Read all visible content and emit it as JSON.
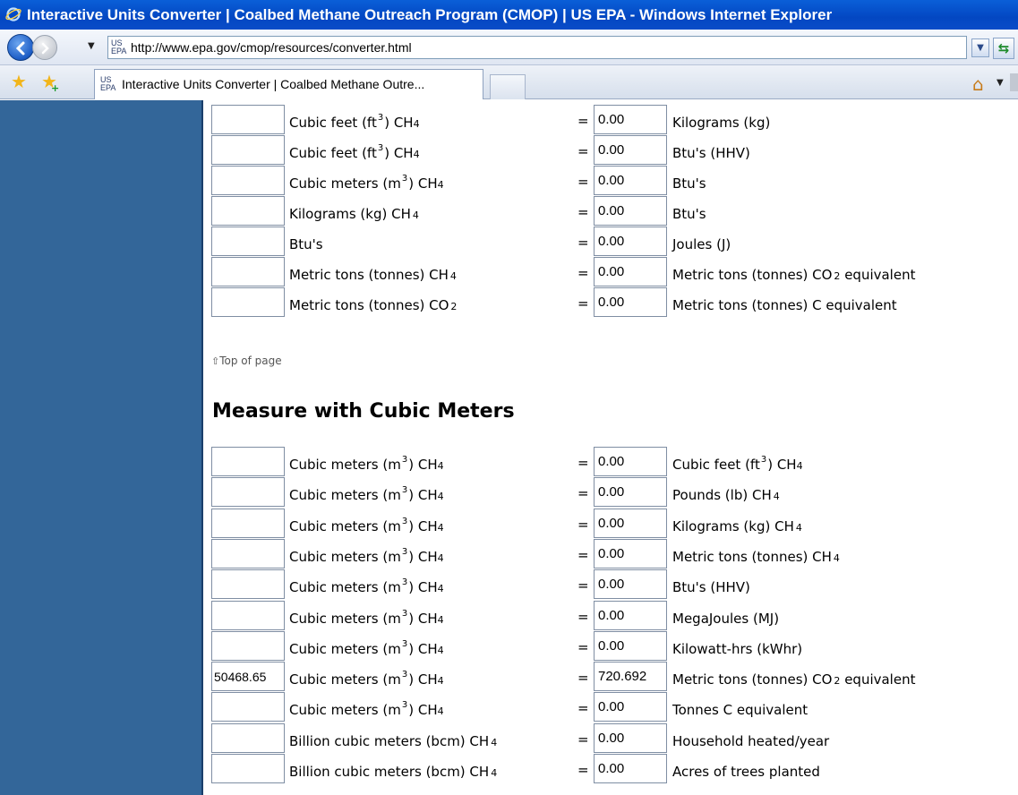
{
  "window": {
    "title": "Interactive Units Converter | Coalbed Methane Outreach Program (CMOP) | US EPA - Windows Internet Explorer"
  },
  "address_bar": {
    "favicon_text": "US EPA",
    "url": "http://www.epa.gov/cmop/resources/converter.html"
  },
  "tab": {
    "favicon_text": "US EPA",
    "label": "Interactive Units Converter | Coalbed Methane Outre..."
  },
  "colors": {
    "sidebar": "#336699",
    "titlebar": "#0a5fd8"
  },
  "section1_rows": [
    {
      "input": "",
      "from_a": "Cubic feet (ft",
      "from_sup": "3",
      "from_b": ") CH",
      "from_sub": "4",
      "output": "0.00",
      "to_a": "Kilograms (kg)",
      "to_sup": "",
      "to_b": "",
      "to_sub": "",
      "to_c": ""
    },
    {
      "input": "",
      "from_a": "Cubic feet (ft",
      "from_sup": "3",
      "from_b": ") CH",
      "from_sub": "4",
      "output": "0.00",
      "to_a": "Btu's (HHV)",
      "to_sup": "",
      "to_b": "",
      "to_sub": "",
      "to_c": ""
    },
    {
      "input": "",
      "from_a": "Cubic meters (m",
      "from_sup": "3",
      "from_b": ") CH",
      "from_sub": "4",
      "output": "0.00",
      "to_a": "Btu's",
      "to_sup": "",
      "to_b": "",
      "to_sub": "",
      "to_c": ""
    },
    {
      "input": "",
      "from_a": "Kilograms (kg) CH",
      "from_sup": "",
      "from_b": "",
      "from_sub": "4",
      "output": "0.00",
      "to_a": "Btu's",
      "to_sup": "",
      "to_b": "",
      "to_sub": "",
      "to_c": ""
    },
    {
      "input": "",
      "from_a": "Btu's",
      "from_sup": "",
      "from_b": "",
      "from_sub": "",
      "output": "0.00",
      "to_a": "Joules (J)",
      "to_sup": "",
      "to_b": "",
      "to_sub": "",
      "to_c": ""
    },
    {
      "input": "",
      "from_a": "Metric tons (tonnes) CH",
      "from_sup": "",
      "from_b": "",
      "from_sub": "4",
      "output": "0.00",
      "to_a": "Metric tons (tonnes) CO",
      "to_sup": "",
      "to_b": "",
      "to_sub": "2",
      "to_c": " equivalent"
    },
    {
      "input": "",
      "from_a": "Metric tons (tonnes) CO",
      "from_sup": "",
      "from_b": "",
      "from_sub": "2",
      "output": "0.00",
      "to_a": "Metric tons (tonnes) C equivalent",
      "to_sup": "",
      "to_b": "",
      "to_sub": "",
      "to_c": ""
    }
  ],
  "top_link": {
    "arrow": "⇧",
    "label": "Top of page"
  },
  "section2": {
    "heading": "Measure with Cubic Meters",
    "rows": [
      {
        "input": "",
        "from_a": "Cubic meters (m",
        "from_sup": "3",
        "from_b": ") CH",
        "from_sub": "4",
        "output": "0.00",
        "to_a": "Cubic feet (ft",
        "to_sup": "3",
        "to_b": ") CH",
        "to_sub": "4",
        "to_c": ""
      },
      {
        "input": "",
        "from_a": "Cubic meters (m",
        "from_sup": "3",
        "from_b": ") CH",
        "from_sub": "4",
        "output": "0.00",
        "to_a": "Pounds (lb) CH",
        "to_sup": "",
        "to_b": "",
        "to_sub": "4",
        "to_c": ""
      },
      {
        "input": "",
        "from_a": "Cubic meters (m",
        "from_sup": "3",
        "from_b": ") CH",
        "from_sub": "4",
        "output": "0.00",
        "to_a": "Kilograms (kg) CH",
        "to_sup": "",
        "to_b": "",
        "to_sub": "4",
        "to_c": ""
      },
      {
        "input": "",
        "from_a": "Cubic meters (m",
        "from_sup": "3",
        "from_b": ") CH",
        "from_sub": "4",
        "output": "0.00",
        "to_a": "Metric tons (tonnes) CH",
        "to_sup": "",
        "to_b": "",
        "to_sub": "4",
        "to_c": ""
      },
      {
        "input": "",
        "from_a": "Cubic meters (m",
        "from_sup": "3",
        "from_b": ") CH",
        "from_sub": "4",
        "output": "0.00",
        "to_a": "Btu's (HHV)",
        "to_sup": "",
        "to_b": "",
        "to_sub": "",
        "to_c": ""
      },
      {
        "input": "",
        "from_a": "Cubic meters (m",
        "from_sup": "3",
        "from_b": ") CH",
        "from_sub": "4",
        "output": "0.00",
        "to_a": "MegaJoules (MJ)",
        "to_sup": "",
        "to_b": "",
        "to_sub": "",
        "to_c": ""
      },
      {
        "input": "",
        "from_a": "Cubic meters (m",
        "from_sup": "3",
        "from_b": ") CH",
        "from_sub": "4",
        "output": "0.00",
        "to_a": "Kilowatt-hrs (kWhr)",
        "to_sup": "",
        "to_b": "",
        "to_sub": "",
        "to_c": ""
      },
      {
        "input": "50468.65",
        "from_a": "Cubic meters (m",
        "from_sup": "3",
        "from_b": ") CH",
        "from_sub": "4",
        "output": "720.692",
        "to_a": "Metric tons (tonnes) CO",
        "to_sup": "",
        "to_b": "",
        "to_sub": "2",
        "to_c": " equivalent"
      },
      {
        "input": "",
        "from_a": "Cubic meters (m",
        "from_sup": "3",
        "from_b": ") CH",
        "from_sub": "4",
        "output": "0.00",
        "to_a": "Tonnes C equivalent",
        "to_sup": "",
        "to_b": "",
        "to_sub": "",
        "to_c": ""
      },
      {
        "input": "",
        "from_a": "Billion cubic meters (bcm) CH",
        "from_sup": "",
        "from_b": "",
        "from_sub": "4",
        "output": "0.00",
        "to_a": "Household heated/year",
        "to_sup": "",
        "to_b": "",
        "to_sub": "",
        "to_c": ""
      },
      {
        "input": "",
        "from_a": "Billion cubic meters (bcm) CH",
        "from_sup": "",
        "from_b": "",
        "from_sub": "4",
        "output": "0.00",
        "to_a": "Acres of trees planted",
        "to_sup": "",
        "to_b": "",
        "to_sub": "",
        "to_c": ""
      }
    ]
  }
}
